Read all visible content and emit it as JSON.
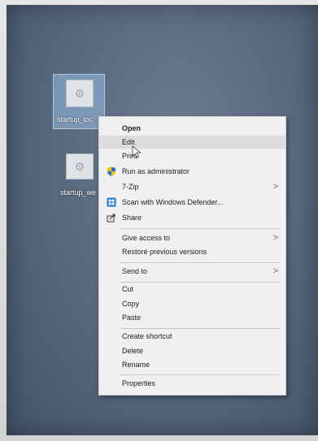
{
  "desktop": {
    "icons": [
      {
        "label": "startup_loc",
        "selected": true
      },
      {
        "label": "startup_we",
        "selected": false
      }
    ]
  },
  "context_menu": {
    "items": [
      {
        "label": "Open",
        "bold": true
      },
      {
        "label": "Edit"
      },
      {
        "label": "Print"
      },
      {
        "label": "Run as administrator",
        "icon": "uac-shield-icon"
      },
      {
        "label": "7-Zip",
        "submenu": true
      },
      {
        "label": "Scan with Windows Defender...",
        "icon": "windows-defender-icon"
      },
      {
        "label": "Share",
        "icon": "share-icon"
      },
      {
        "label": "Give access to",
        "submenu": true
      },
      {
        "label": "Restore previous versions"
      },
      {
        "label": "Send to",
        "submenu": true
      },
      {
        "label": "Cut"
      },
      {
        "label": "Copy"
      },
      {
        "label": "Paste"
      },
      {
        "label": "Create shortcut"
      },
      {
        "label": "Delete"
      },
      {
        "label": "Rename"
      },
      {
        "label": "Properties"
      }
    ],
    "submenu_arrow": ">"
  },
  "colors": {
    "desktop_background": "#5a6a7f",
    "menu_background": "#f0f0f0",
    "hover_highlight": "#dcdcdc"
  }
}
